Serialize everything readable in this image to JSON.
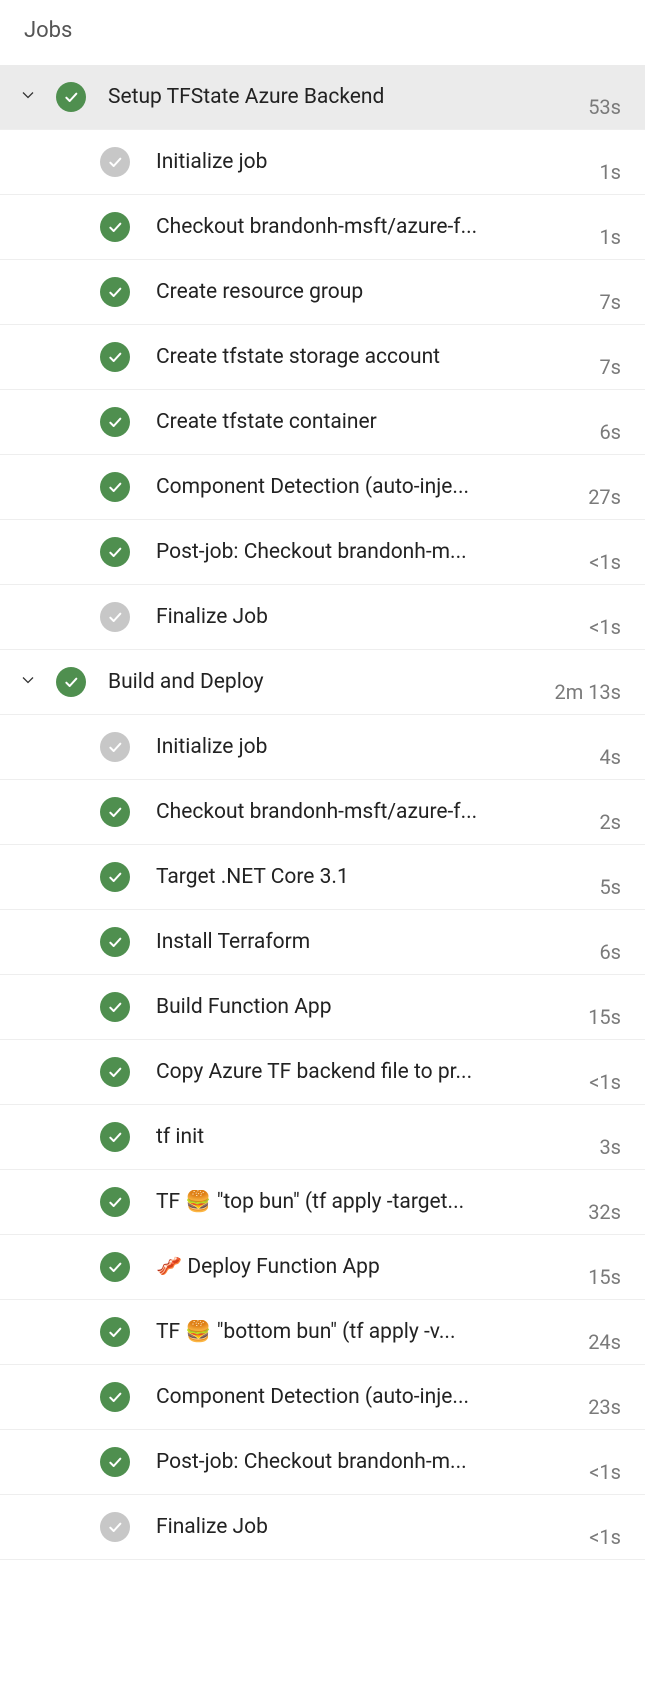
{
  "header": "Jobs",
  "jobs": [
    {
      "name": "Setup TFState Azure Backend",
      "duration": "53s",
      "status": "success",
      "expanded": true,
      "steps": [
        {
          "name": "Initialize job",
          "duration": "1s",
          "status": "neutral"
        },
        {
          "name": "Checkout brandonh-msft/azure-f...",
          "duration": "1s",
          "status": "success"
        },
        {
          "name": "Create resource group",
          "duration": "7s",
          "status": "success"
        },
        {
          "name": "Create tfstate storage account",
          "duration": "7s",
          "status": "success"
        },
        {
          "name": "Create tfstate container",
          "duration": "6s",
          "status": "success"
        },
        {
          "name": "Component Detection (auto-inje...",
          "duration": "27s",
          "status": "success"
        },
        {
          "name": "Post-job: Checkout brandonh-m...",
          "duration": "<1s",
          "status": "success"
        },
        {
          "name": "Finalize Job",
          "duration": "<1s",
          "status": "neutral"
        }
      ]
    },
    {
      "name": "Build and Deploy",
      "duration": "2m 13s",
      "status": "success",
      "expanded": true,
      "steps": [
        {
          "name": "Initialize job",
          "duration": "4s",
          "status": "neutral"
        },
        {
          "name": "Checkout brandonh-msft/azure-f...",
          "duration": "2s",
          "status": "success"
        },
        {
          "name": "Target .NET Core 3.1",
          "duration": "5s",
          "status": "success"
        },
        {
          "name": "Install Terraform",
          "duration": "6s",
          "status": "success"
        },
        {
          "name": "Build Function App",
          "duration": "15s",
          "status": "success"
        },
        {
          "name": "Copy Azure TF backend file to pr...",
          "duration": "<1s",
          "status": "success"
        },
        {
          "name": "tf init",
          "duration": "3s",
          "status": "success"
        },
        {
          "name": "TF 🍔 \"top bun\" (tf apply -target...",
          "duration": "32s",
          "status": "success"
        },
        {
          "name": "🥓 Deploy Function App",
          "duration": "15s",
          "status": "success"
        },
        {
          "name": "TF 🍔 \"bottom bun\" (tf apply -v...",
          "duration": "24s",
          "status": "success"
        },
        {
          "name": "Component Detection (auto-inje...",
          "duration": "23s",
          "status": "success"
        },
        {
          "name": "Post-job: Checkout brandonh-m...",
          "duration": "<1s",
          "status": "success"
        },
        {
          "name": "Finalize Job",
          "duration": "<1s",
          "status": "neutral"
        }
      ]
    }
  ]
}
